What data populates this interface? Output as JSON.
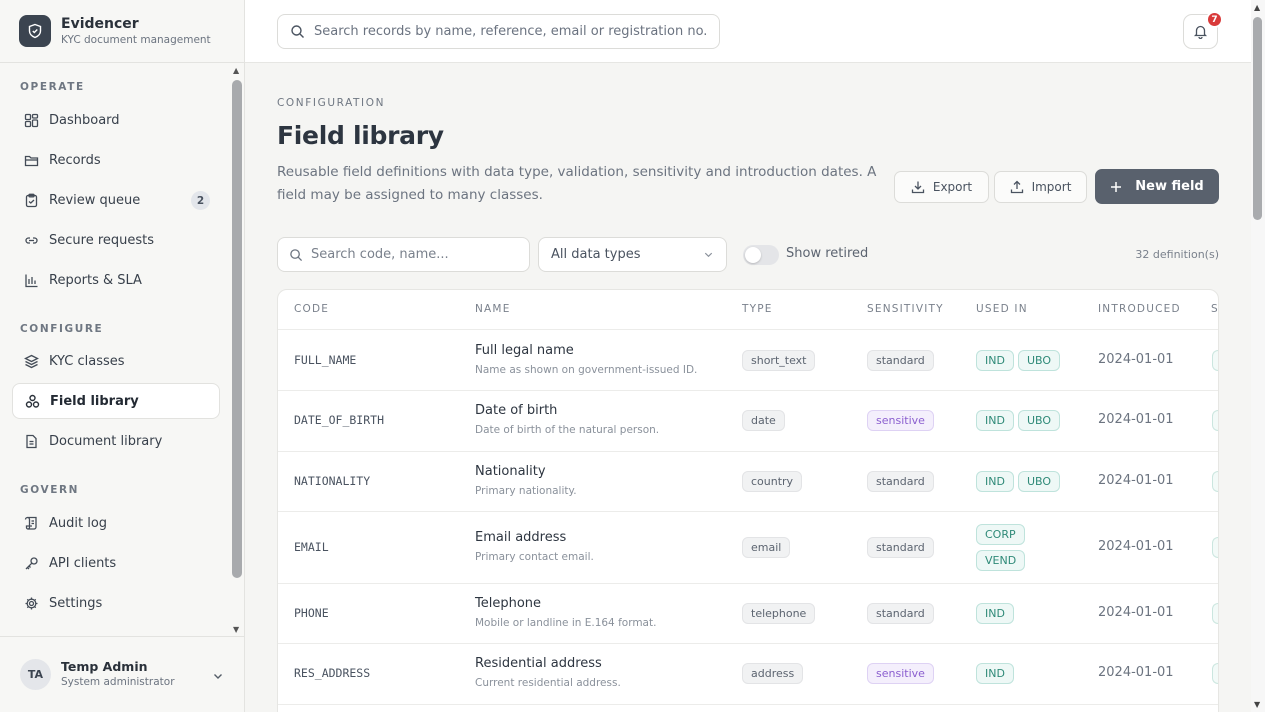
{
  "app": {
    "name": "Evidencer",
    "subtitle": "KYC document management"
  },
  "search": {
    "placeholder": "Search records by name, reference, email or registration no."
  },
  "notifications": {
    "count": "7"
  },
  "nav": {
    "sections": [
      {
        "title": "OPERATE",
        "items": [
          {
            "label": "Dashboard",
            "icon": "grid-icon"
          },
          {
            "label": "Records",
            "icon": "folder-icon"
          },
          {
            "label": "Review queue",
            "icon": "clipboard-icon",
            "badge": "2"
          },
          {
            "label": "Secure requests",
            "icon": "link-icon"
          },
          {
            "label": "Reports & SLA",
            "icon": "bar-chart-icon"
          }
        ]
      },
      {
        "title": "CONFIGURE",
        "items": [
          {
            "label": "KYC classes",
            "icon": "layers-icon"
          },
          {
            "label": "Field library",
            "icon": "shapes-icon",
            "active": true
          },
          {
            "label": "Document library",
            "icon": "document-icon"
          }
        ]
      },
      {
        "title": "GOVERN",
        "items": [
          {
            "label": "Audit log",
            "icon": "scroll-icon"
          },
          {
            "label": "API clients",
            "icon": "key-icon"
          },
          {
            "label": "Settings",
            "icon": "gear-icon"
          }
        ]
      }
    ]
  },
  "user": {
    "initials": "TA",
    "name": "Temp Admin",
    "role": "System administrator"
  },
  "page": {
    "eyebrow": "CONFIGURATION",
    "title": "Field library",
    "description": "Reusable field definitions with data type, validation, sensitivity and introduction dates. A field may be assigned to many classes.",
    "export_label": "Export",
    "import_label": "Import",
    "new_label": "New field"
  },
  "filters": {
    "search_placeholder": "Search code, name...",
    "type_value": "All data types",
    "retired_label": "Show retired",
    "retired_on": false,
    "count_text": "32 definition(s)"
  },
  "table": {
    "headers": [
      "CODE",
      "NAME",
      "TYPE",
      "SENSITIVITY",
      "USED IN",
      "INTRODUCED",
      "S"
    ],
    "rows": [
      {
        "code": "FULL_NAME",
        "name": "Full legal name",
        "desc": "Name as shown on government-issued ID.",
        "type": "short_text",
        "sensitivity": "standard",
        "classes": [
          "IND",
          "UBO"
        ],
        "introduced": "2024-01-01"
      },
      {
        "code": "DATE_OF_BIRTH",
        "name": "Date of birth",
        "desc": "Date of birth of the natural person.",
        "type": "date",
        "sensitivity": "sensitive",
        "classes": [
          "IND",
          "UBO"
        ],
        "introduced": "2024-01-01"
      },
      {
        "code": "NATIONALITY",
        "name": "Nationality",
        "desc": "Primary nationality.",
        "type": "country",
        "sensitivity": "standard",
        "classes": [
          "IND",
          "UBO"
        ],
        "introduced": "2024-01-01"
      },
      {
        "code": "EMAIL",
        "name": "Email address",
        "desc": "Primary contact email.",
        "type": "email",
        "sensitivity": "standard",
        "classes": [
          "CORP",
          "VEND"
        ],
        "introduced": "2024-01-01"
      },
      {
        "code": "PHONE",
        "name": "Telephone",
        "desc": "Mobile or landline in E.164 format.",
        "type": "telephone",
        "sensitivity": "standard",
        "classes": [
          "IND"
        ],
        "introduced": "2024-01-01"
      },
      {
        "code": "RES_ADDRESS",
        "name": "Residential address",
        "desc": "Current residential address.",
        "type": "address",
        "sensitivity": "sensitive",
        "classes": [
          "IND"
        ],
        "introduced": "2024-01-01"
      }
    ]
  },
  "colors": {
    "primary": "#59616d",
    "sensitive": "#8b5fcf",
    "class_tag": "#2f8a78",
    "badge": "#d93a3a"
  }
}
